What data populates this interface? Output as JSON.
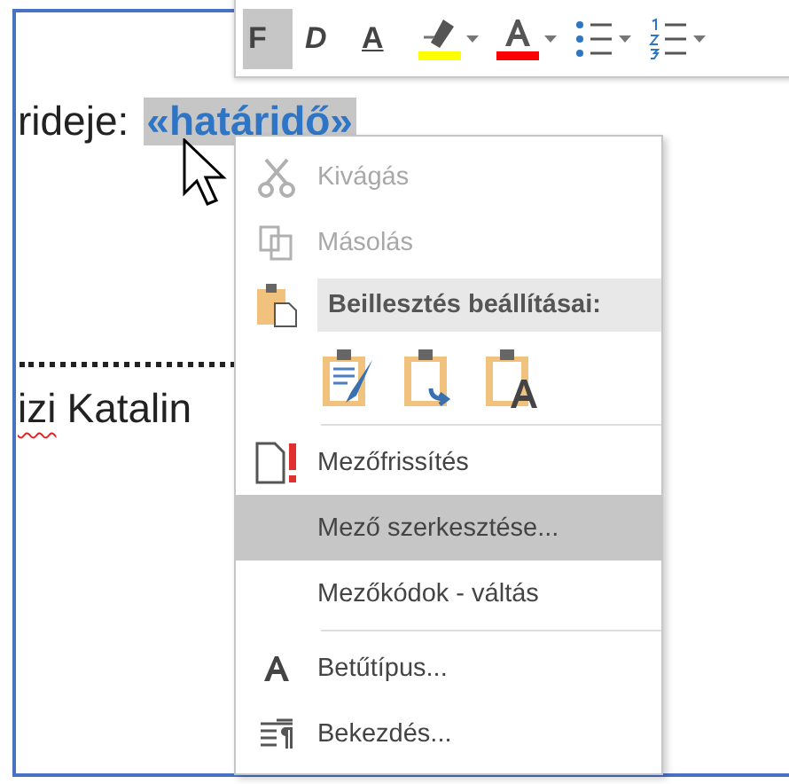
{
  "toolbar": {
    "buttons": [
      {
        "kind": "bold",
        "label": "F",
        "selected": true
      },
      {
        "kind": "italic",
        "label": "D",
        "selected": false
      },
      {
        "kind": "underline",
        "label": "A",
        "selected": false
      },
      {
        "kind": "highlight",
        "color": "#ffff00",
        "selected": false
      },
      {
        "kind": "font_color",
        "color": "#ff0000",
        "selected": false
      },
      {
        "kind": "bullets",
        "selected": false
      },
      {
        "kind": "numbering",
        "selected": false
      }
    ]
  },
  "document": {
    "label": "rideje:",
    "field": {
      "text": "«határidő»",
      "selected": true
    },
    "signer": [
      {
        "text": "izi",
        "misspelled": true
      },
      {
        "text": "Katalin",
        "misspelled": false
      }
    ]
  },
  "context_menu": {
    "items": [
      {
        "kind": "cut",
        "label": "Kivágás",
        "disabled": true,
        "selected": false
      },
      {
        "kind": "copy",
        "label": "Másolás",
        "disabled": true,
        "selected": false
      },
      {
        "kind": "paste_header",
        "label": "Beillesztés beállításai:"
      },
      {
        "kind": "paste_options"
      },
      {
        "kind": "separator"
      },
      {
        "kind": "update_field",
        "label": "Mezőfrissítés",
        "disabled": false,
        "selected": false
      },
      {
        "kind": "edit_field",
        "label": "Mező szerkesztése...",
        "disabled": false,
        "selected": true
      },
      {
        "kind": "toggle_codes",
        "label": "Mezőkódok - váltás",
        "disabled": false,
        "selected": false
      },
      {
        "kind": "separator"
      },
      {
        "kind": "font",
        "label": "Betűtípus...",
        "disabled": false,
        "selected": false
      },
      {
        "kind": "paragraph",
        "label": "Bekezdés...",
        "disabled": false,
        "selected": false
      }
    ]
  }
}
